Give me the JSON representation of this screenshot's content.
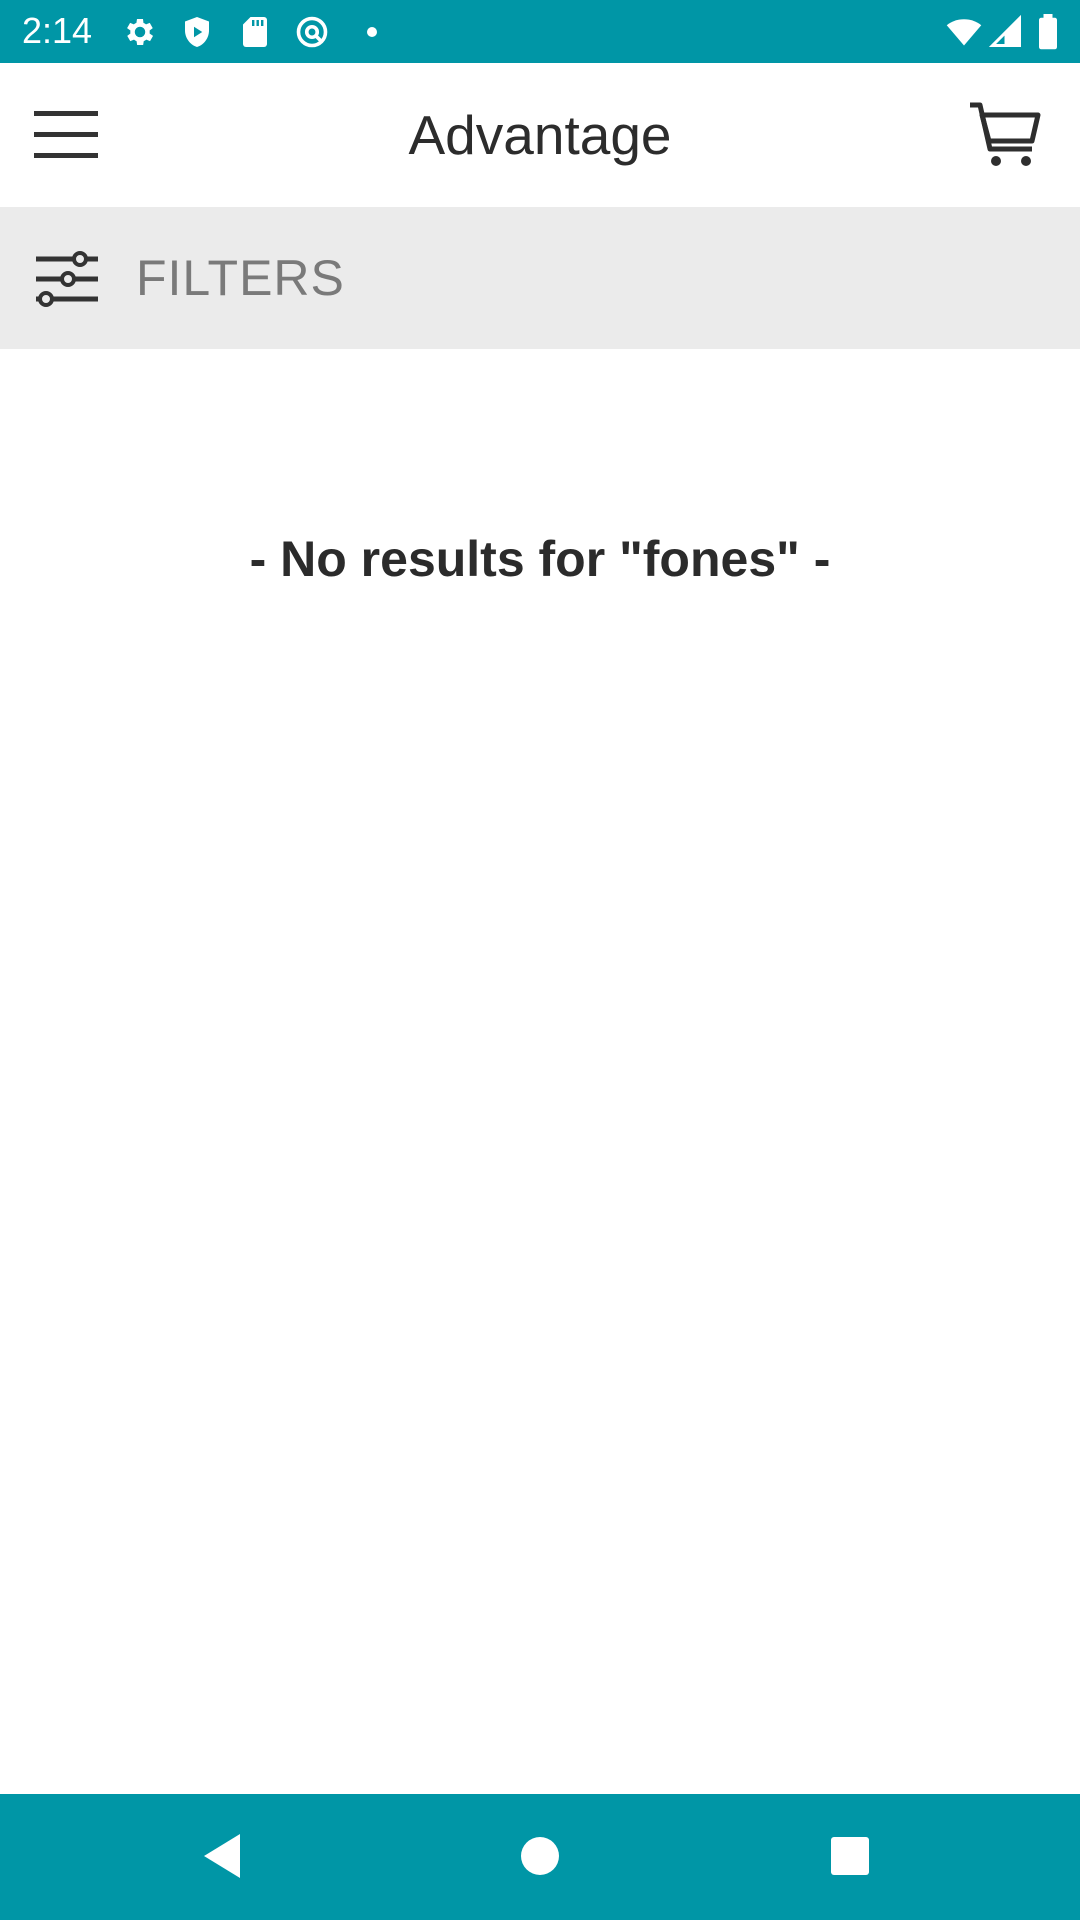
{
  "status_bar": {
    "time": "2:14",
    "icons": [
      "settings-icon",
      "shield-play-icon",
      "sd-card-icon",
      "at-sign-icon",
      "dot-icon",
      "wifi-icon",
      "signal-icon",
      "battery-icon"
    ]
  },
  "app_bar": {
    "title": "Advantage",
    "menu_icon": "hamburger-menu-icon",
    "cart_icon": "shopping-cart-icon"
  },
  "filters": {
    "label": "FILTERS",
    "icon": "sliders-icon"
  },
  "results": {
    "message": "- No results for \"fones\" -"
  },
  "nav_bar": {
    "icons": [
      "back-icon",
      "home-icon",
      "recents-icon"
    ]
  },
  "colors": {
    "accent": "#0096a6",
    "filters_background": "#ebebeb",
    "text_dark": "#2b2b2b",
    "text_muted": "#7a7a7a"
  }
}
